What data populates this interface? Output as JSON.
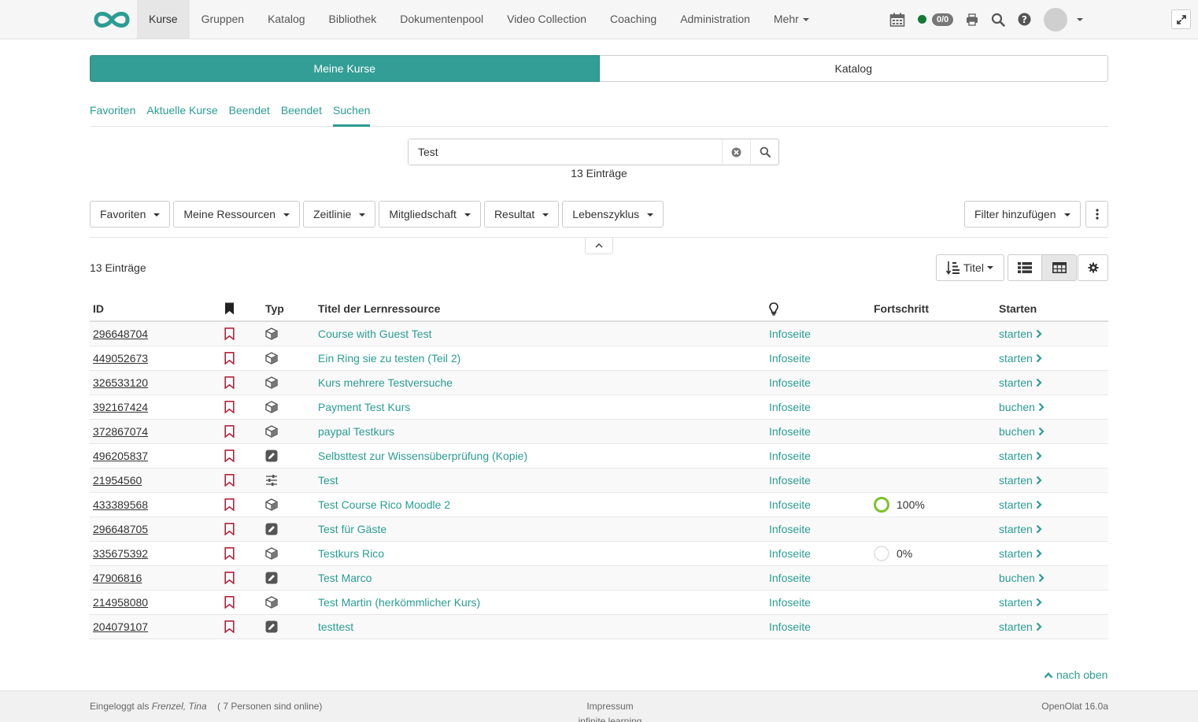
{
  "nav": {
    "items": [
      "Kurse",
      "Gruppen",
      "Katalog",
      "Bibliothek",
      "Dokumentenpool",
      "Video Collection",
      "Coaching",
      "Administration",
      "Mehr"
    ],
    "badge": "0/0"
  },
  "segment": {
    "left": "Meine Kurse",
    "right": "Katalog"
  },
  "subtabs": [
    "Favoriten",
    "Aktuelle Kurse",
    "Beendet",
    "Beendet",
    "Suchen"
  ],
  "search": {
    "value": "Test",
    "count": "13 Einträge"
  },
  "filters": [
    "Favoriten",
    "Meine Ressourcen",
    "Zeitlinie",
    "Mitgliedschaft",
    "Resultat",
    "Lebenszyklus"
  ],
  "add_filter": "Filter hinzufügen",
  "result_count": "13 Einträge",
  "sort_label": "Titel",
  "table": {
    "headers": {
      "id": "ID",
      "typ": "Typ",
      "title": "Titel der Lernressource",
      "progress": "Fortschritt",
      "start": "Starten"
    },
    "rows": [
      {
        "id": "296648704",
        "type": "course",
        "title": "Course with Guest Test",
        "info": "Infoseite",
        "progress": "",
        "action": "starten"
      },
      {
        "id": "449052673",
        "type": "course",
        "title": "Ein Ring sie zu testen (Teil 2)",
        "info": "Infoseite",
        "progress": "",
        "action": "starten"
      },
      {
        "id": "326533120",
        "type": "course",
        "title": "Kurs mehrere Testversuche",
        "info": "Infoseite",
        "progress": "",
        "action": "starten"
      },
      {
        "id": "392167424",
        "type": "course",
        "title": "Payment Test Kurs",
        "info": "Infoseite",
        "progress": "",
        "action": "buchen"
      },
      {
        "id": "372867074",
        "type": "course",
        "title": "paypal Testkurs",
        "info": "Infoseite",
        "progress": "",
        "action": "buchen"
      },
      {
        "id": "496205837",
        "type": "test",
        "title": "Selbsttest zur Wissensüberprüfung (Kopie)",
        "info": "Infoseite",
        "progress": "",
        "action": "starten"
      },
      {
        "id": "21954560",
        "type": "sliders",
        "title": "Test",
        "info": "Infoseite",
        "progress": "",
        "action": "starten"
      },
      {
        "id": "433389568",
        "type": "course",
        "title": "Test Course Rico Moodle 2",
        "info": "Infoseite",
        "progress": "100%",
        "action": "starten"
      },
      {
        "id": "296648705",
        "type": "test",
        "title": "Test für Gäste",
        "info": "Infoseite",
        "progress": "",
        "action": "starten"
      },
      {
        "id": "335675392",
        "type": "course",
        "title": "Testkurs Rico",
        "info": "Infoseite",
        "progress": "0%",
        "action": "starten"
      },
      {
        "id": "47906816",
        "type": "test",
        "title": "Test Marco",
        "info": "Infoseite",
        "progress": "",
        "action": "buchen"
      },
      {
        "id": "214958080",
        "type": "course",
        "title": "Test Martin (herkömmlicher Kurs)",
        "info": "Infoseite",
        "progress": "",
        "action": "starten"
      },
      {
        "id": "204079107",
        "type": "test",
        "title": "testtest",
        "info": "Infoseite",
        "progress": "",
        "action": "starten"
      }
    ]
  },
  "back_to_top": "nach oben",
  "footer": {
    "logged_in_prefix": "Eingeloggt als",
    "user": "Frenzel, Tina",
    "online": "( 7 Personen sind online)",
    "impressum": "Impressum",
    "tagline": "infinite learning",
    "version": "OpenOlat 16.0a"
  },
  "colors": {
    "accent": "#2a9d93",
    "segment_active": "#339e96",
    "bookmark": "#b3243c",
    "progress_done": "#7dc12a",
    "online": "#137a33"
  }
}
